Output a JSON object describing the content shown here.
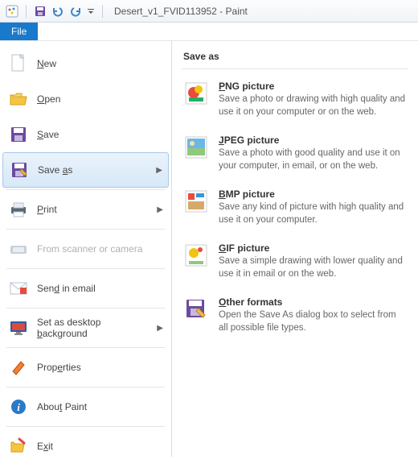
{
  "title": "Desert_v1_FVID113952 - Paint",
  "file_tab": "File",
  "menu": {
    "new": "New",
    "open": "Open",
    "save": "Save",
    "save_as": "Save as",
    "print": "Print",
    "scanner": "From scanner or camera",
    "email": "Send in email",
    "desktop": "Set as desktop background",
    "properties": "Properties",
    "about": "About Paint",
    "exit": "Exit"
  },
  "right": {
    "header": "Save as",
    "png_title": "PNG picture",
    "png_desc": "Save a photo or drawing with high quality and use it on your computer or on the web.",
    "jpeg_title": "JPEG picture",
    "jpeg_desc": "Save a photo with good quality and use it on your computer, in email, or on the web.",
    "bmp_title": "BMP picture",
    "bmp_desc": "Save any kind of picture with high quality and use it on your computer.",
    "gif_title": "GIF picture",
    "gif_desc": "Save a simple drawing with lower quality and use it in email or on the web.",
    "other_title": "Other formats",
    "other_desc": "Open the Save As dialog box to select from all possible file types."
  }
}
